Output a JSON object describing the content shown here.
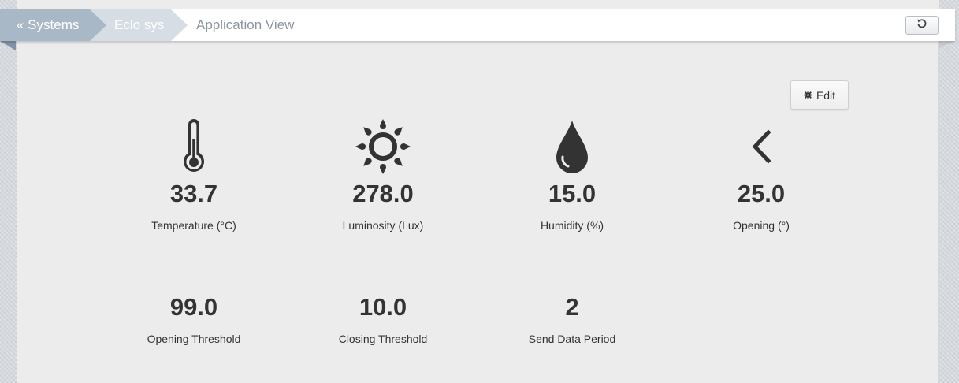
{
  "breadcrumb": {
    "items": [
      "« Systems",
      "Eclo sys"
    ],
    "current": "Application View"
  },
  "toolbar": {
    "refresh_icon": "undo-icon",
    "edit_label": "Edit",
    "edit_icon": "gear-icon"
  },
  "metrics": [
    {
      "icon": "thermometer-icon",
      "value": "33.7",
      "label": "Temperature (°C)"
    },
    {
      "icon": "sun-icon",
      "value": "278.0",
      "label": "Luminosity (Lux)"
    },
    {
      "icon": "droplet-icon",
      "value": "15.0",
      "label": "Humidity (%)"
    },
    {
      "icon": "chevron-left-icon",
      "value": "25.0",
      "label": "Opening (°)"
    }
  ],
  "settings": [
    {
      "value": "99.0",
      "label": "Opening Threshold"
    },
    {
      "value": "10.0",
      "label": "Closing Threshold"
    },
    {
      "value": "2",
      "label": "Send Data Period"
    }
  ],
  "colors": {
    "text": "#333333",
    "breadcrumb_active": "#a9b8c7",
    "breadcrumb_secondary": "#d6dde4",
    "panel_background": "#ececec"
  }
}
